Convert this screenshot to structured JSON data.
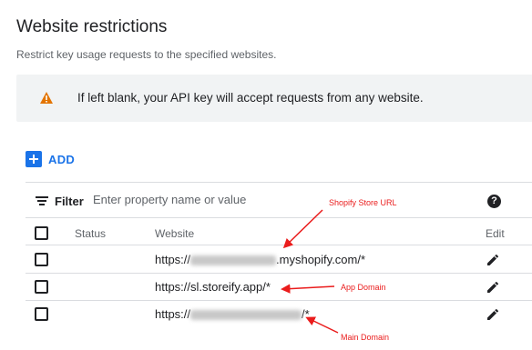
{
  "section": {
    "title": "Website restrictions",
    "subtitle": "Restrict key usage requests to the specified websites."
  },
  "warning": {
    "icon": "warning-icon",
    "text": "If left blank, your API key will accept requests from any website.",
    "color": "#e37400"
  },
  "add_button": {
    "label": "ADD",
    "icon": "plus-icon",
    "color": "#1a73e8"
  },
  "filter": {
    "label": "Filter",
    "placeholder": "Enter property name or value",
    "icon": "filter-icon",
    "help_icon": "help-icon"
  },
  "table": {
    "columns": {
      "status": "Status",
      "website": "Website",
      "edit": "Edit"
    },
    "rows": [
      {
        "prefix": "https://",
        "suffix": ".myshopify.com/*",
        "redacted": true
      },
      {
        "prefix": "https://sl.storeify.app/*",
        "suffix": "",
        "redacted": false
      },
      {
        "prefix": "https://",
        "suffix": "/*",
        "redacted": true
      }
    ]
  },
  "annotations": {
    "shopify": "Shopify Store URL",
    "app": "App Domain",
    "main": "Main Domain",
    "color": "#ea1c1c"
  }
}
